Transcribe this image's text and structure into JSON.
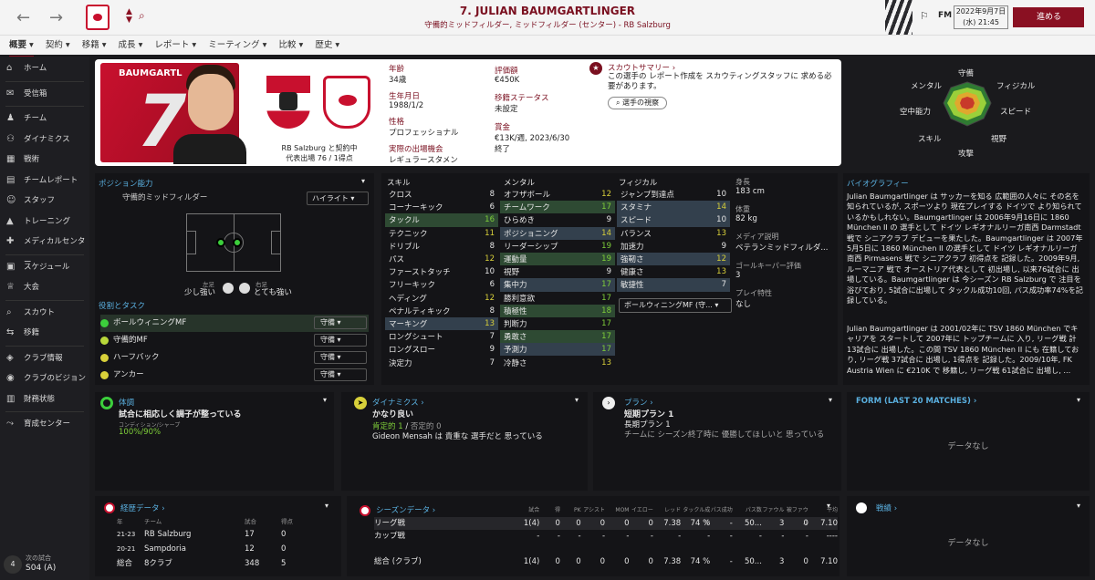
{
  "topbar": {
    "title": "7. JULIAN BAUMGARTLINGER",
    "subtitle": "守備的ミッドフィルダー, ミッドフィルダー (センター) - RB Salzburg",
    "fm": "FM",
    "date_line1": "2022年9月7日",
    "date_line2": "(水) 21:45",
    "continue_label": "進める"
  },
  "menu": [
    "概要",
    "契約",
    "移籍",
    "成長",
    "レポート",
    "ミーティング",
    "比較",
    "歴史"
  ],
  "sidebar": [
    {
      "label": "ホーム",
      "icon": "home-icon"
    },
    {
      "label": "受信箱",
      "icon": "inbox-icon"
    },
    {
      "label": "チーム",
      "icon": "team-icon"
    },
    {
      "label": "ダイナミクス",
      "icon": "dynamics-icon"
    },
    {
      "label": "戦術",
      "icon": "tactics-icon"
    },
    {
      "label": "チームレポート",
      "icon": "report-icon"
    },
    {
      "label": "スタッフ",
      "icon": "staff-icon"
    },
    {
      "label": "トレーニング",
      "icon": "training-icon"
    },
    {
      "label": "メディカルセンター",
      "icon": "medical-icon"
    },
    {
      "label": "スケジュール",
      "icon": "calendar-icon"
    },
    {
      "label": "大会",
      "icon": "trophy-icon"
    },
    {
      "label": "スカウト",
      "icon": "scout-icon"
    },
    {
      "label": "移籍",
      "icon": "transfer-icon"
    },
    {
      "label": "クラブ情報",
      "icon": "club-icon"
    },
    {
      "label": "クラブのビジョン",
      "icon": "vision-icon"
    },
    {
      "label": "財務状態",
      "icon": "finance-icon"
    },
    {
      "label": "育成センター",
      "icon": "youth-icon"
    }
  ],
  "next_match": {
    "label": "次の試合",
    "value": "S04 (A)"
  },
  "header": {
    "name_strip": "BAUMGARTL",
    "club_line1": "RB Salzburg と契約中",
    "club_line2": "代表出場 76 / 1得点",
    "age_label": "年齢",
    "age": "34歳",
    "dob_label": "生年月日",
    "dob": "1988/1/2",
    "personality_label": "性格",
    "personality": "プロフェッショナル",
    "playing_time_label": "実際の出場機会",
    "playing_time": "レギュラースタメン",
    "value_label": "評価額",
    "value": "€450K",
    "transfer_label": "移籍ステータス",
    "transfer": "未設定",
    "wage_label": "賞金",
    "wage": "€13K/週, 2023/6/30",
    "wage2": "終了",
    "scout_label": "スカウトサマリー",
    "scout_text": "この選手の レポート作成を スカウティングスタッフに 求める必要があります。",
    "scout_btn": "選手の視察"
  },
  "radar": {
    "labels": [
      "守備",
      "フィジカル",
      "スピード",
      "視野",
      "攻撃",
      "スキル",
      "空中能力",
      "メンタル"
    ]
  },
  "position": {
    "title": "ポジション能力",
    "pos": "守備的ミッドフィルダー",
    "highlight": "ハイライト",
    "left_foot_label": "左足",
    "left_foot": "少し強い",
    "right_foot_label": "右足",
    "right_foot": "とても強い"
  },
  "roles": {
    "title": "役割とタスク",
    "items": [
      {
        "name": "ボールウィニングMF",
        "duty": "守備",
        "color": "#3ccf3c"
      },
      {
        "name": "守備的MF",
        "duty": "守備",
        "color": "#b8d83a"
      },
      {
        "name": "ハーフバック",
        "duty": "守備",
        "color": "#d8d03a"
      },
      {
        "name": "アンカー",
        "duty": "守備",
        "color": "#d8d03a"
      }
    ]
  },
  "skills": {
    "title": "スキル",
    "rows": [
      [
        "クロス",
        "8"
      ],
      [
        "コーナーキック",
        "6"
      ],
      [
        "タックル",
        "16"
      ],
      [
        "テクニック",
        "11"
      ],
      [
        "ドリブル",
        "8"
      ],
      [
        "パス",
        "12"
      ],
      [
        "ファーストタッチ",
        "10"
      ],
      [
        "フリーキック",
        "6"
      ],
      [
        "ヘディング",
        "12"
      ],
      [
        "ペナルティキック",
        "8"
      ],
      [
        "マーキング",
        "13"
      ],
      [
        "ロングシュート",
        "7"
      ],
      [
        "ロングスロー",
        "9"
      ],
      [
        "決定力",
        "7"
      ]
    ]
  },
  "mental": {
    "title": "メンタル",
    "rows": [
      [
        "オフザボール",
        "12"
      ],
      [
        "チームワーク",
        "17"
      ],
      [
        "ひらめき",
        "9"
      ],
      [
        "ポジショニング",
        "14"
      ],
      [
        "リーダーシップ",
        "19"
      ],
      [
        "運動量",
        "19"
      ],
      [
        "視野",
        "9"
      ],
      [
        "集中力",
        "17"
      ],
      [
        "勝利意欲",
        "17"
      ],
      [
        "積極性",
        "18"
      ],
      [
        "判断力",
        "17"
      ],
      [
        "勇敢さ",
        "17"
      ],
      [
        "予測力",
        "17"
      ],
      [
        "冷静さ",
        "13"
      ]
    ]
  },
  "physical": {
    "title": "フィジカル",
    "rows": [
      [
        "ジャンプ到達点",
        "10"
      ],
      [
        "スタミナ",
        "14"
      ],
      [
        "スピード",
        "10"
      ],
      [
        "バランス",
        "13"
      ],
      [
        "加速力",
        "9"
      ],
      [
        "強靭さ",
        "12"
      ],
      [
        "健康さ",
        "13"
      ],
      [
        "敏捷性",
        "7"
      ]
    ],
    "role_select": "ボールウィニングMF (守..."
  },
  "info": {
    "height_label": "身長",
    "height": "183 cm",
    "weight_label": "体重",
    "weight": "82 kg",
    "media_label": "メディア説明",
    "media": "ベテランミッドフィルダ...",
    "gk_label": "ゴールキーパー評価",
    "gk": "3",
    "traits_label": "プレイ特性",
    "traits": "なし"
  },
  "bio": {
    "title": "バイオグラフィー",
    "p1": "Julian Baumgartlinger は サッカーを知る 広範囲の人々に その名を知られているが, スポーツより 現在プレイする ドイツで より知られているかもしれない。Baumgartlinger は 2006年9月16日に 1860 München II の 選手として ドイツ レギオナルリーガ南西 Darmstadt 戦で シニアクラブ デビューを果たした。Baumgartlinger は 2007年5月5日に 1860 München II の選手として ドイツ レギオナルリーガ南西 Pirmasens 戦で シニアクラブ 初得点を 記録した。2009年9月, ルーマニア 戦で オーストリア代表として 初出場し, 以来76試合に 出場している。Baumgartlinger は 今シーズン RB Salzburg で 注目を 浴びており, 5試合に出場して タックル成功10回, パス成功率74%を記録している。",
    "p2": "Julian Baumgartlinger は 2001/02年に TSV 1860 München でキャリアを スタートして 2007年に トップチームに 入り, リーグ戦 計13試合に 出場した。この間 TSV 1860 München II にも 在籍しており, リーグ戦 37試合に 出場し, 1得点を 記録した。2009/10年, FK Austria Wien に €210K で 移籍し, リーグ戦 61試合に 出場し, ..."
  },
  "condition": {
    "title": "体調",
    "text": "試合に相応しく調子が整っている",
    "sub": "コンディション/シャープ",
    "value": "100%/90%"
  },
  "dynamics": {
    "title": "ダイナミクス",
    "text": "かなり良い",
    "positive": "肯定的 1",
    "negative": "否定的 0",
    "note": "Gideon Mensah は 貴重な 選手だと 思っている"
  },
  "plan": {
    "title": "プラン",
    "short": "短期プラン 1",
    "long": "長期プラン 1",
    "note": "チームに シーズン終了時に 優勝してほしいと 思っている"
  },
  "form": {
    "title": "FORM (LAST 20 MATCHES)",
    "empty": "データなし"
  },
  "career": {
    "title": "経歴データ",
    "headers": [
      "年",
      "チーム",
      "試合",
      "得点"
    ],
    "rows": [
      [
        "21-23",
        "RB Salzburg",
        "17",
        "0"
      ],
      [
        "20-21",
        "Sampdoria",
        "12",
        "0"
      ],
      [
        "総合",
        "8クラブ",
        "348",
        "5"
      ]
    ]
  },
  "season": {
    "title": "シーズンデータ",
    "headers": [
      "試合",
      "得",
      "PK",
      "アシスト",
      "MOM",
      "イエロー",
      "レッド",
      "タックル成功",
      "パス成功",
      "パス数",
      "ファウル",
      "被ファウル",
      "平均"
    ],
    "rows": [
      [
        "リーグ戦",
        "1(4)",
        "0",
        "0",
        "0",
        "0",
        "0",
        "7.38",
        "74 %",
        "-",
        "50...",
        "3",
        "0",
        "7.10"
      ],
      [
        "カップ戦",
        "-",
        "-",
        "-",
        "-",
        "-",
        "-",
        "-",
        "-",
        "-",
        "-",
        "-",
        "-",
        "----"
      ],
      [
        "総合 (クラブ)",
        "1(4)",
        "0",
        "0",
        "0",
        "0",
        "0",
        "7.38",
        "74 %",
        "-",
        "50...",
        "3",
        "0",
        "7.10"
      ]
    ]
  },
  "record": {
    "title": "戦績",
    "empty": "データなし"
  },
  "colors": {
    "accent": "#8a1022",
    "green": "#7fcf3a",
    "yellow": "#d8d03a",
    "blue": "#5ab0e0"
  }
}
